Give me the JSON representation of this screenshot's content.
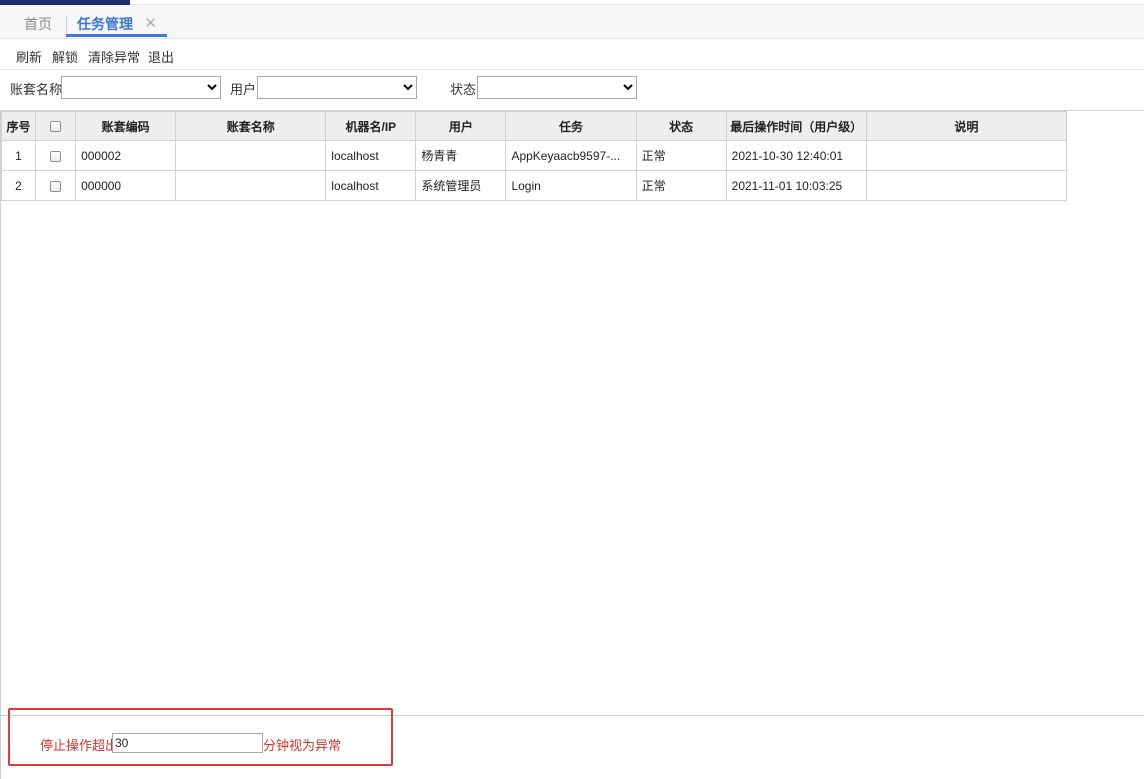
{
  "tabs": {
    "home": "首页",
    "active": "任务管理",
    "close_glyph": "✕"
  },
  "toolbar": {
    "refresh": "刷新",
    "unlock": "解锁",
    "clear_exception": "清除异常",
    "exit": "退出"
  },
  "filters": {
    "account_set_label": "账套名称",
    "user_label": "用户",
    "status_label": "状态",
    "account_set_value": "",
    "user_value": "",
    "status_value": ""
  },
  "table": {
    "headers": {
      "index": "序号",
      "code": "账套编码",
      "name": "账套名称",
      "machine": "机器名/IP",
      "user": "用户",
      "task": "任务",
      "status": "状态",
      "last_op": "最后操作时间（用户级）",
      "desc": "说明"
    },
    "rows": [
      {
        "index": "1",
        "code": "000002",
        "name": "",
        "machine": "localhost",
        "user": "杨青青",
        "task": "AppKeyaacb9597-...",
        "status": "正常",
        "last_op": "2021-10-30 12:40:01",
        "desc": ""
      },
      {
        "index": "2",
        "code": "000000",
        "name": "",
        "machine": "localhost",
        "user": "系统管理员",
        "task": "Login",
        "status": "正常",
        "last_op": "2021-11-01 10:03:25",
        "desc": ""
      }
    ]
  },
  "footer": {
    "prefix": "停止操作超出",
    "minutes_value": "30",
    "suffix": "分钟视为异常"
  },
  "colors": {
    "accent": "#3c78d8",
    "warning_text": "#d9342b",
    "highlight_border": "#e53935"
  }
}
